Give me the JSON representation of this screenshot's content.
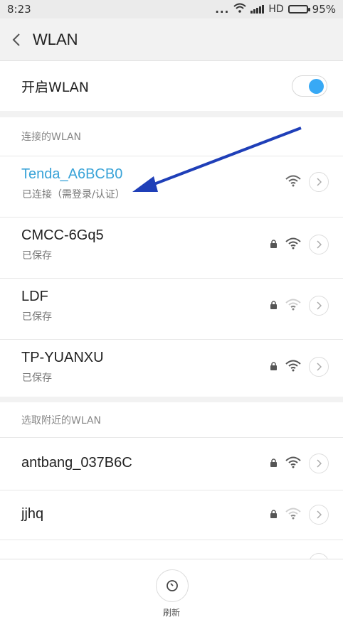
{
  "status_bar": {
    "time": "8:23",
    "dots": "...",
    "network": "HD",
    "battery_percent": "95%",
    "battery_level": 0.95
  },
  "header": {
    "title": "WLAN"
  },
  "wlan_toggle": {
    "label": "开启WLAN",
    "enabled": true
  },
  "connected_section": {
    "heading": "连接的WLAN",
    "networks": [
      {
        "name": "Tenda_A6BCB0",
        "status": "已连接（需登录/认证）",
        "secured": false,
        "signal": 3
      },
      {
        "name": "CMCC-6Gq5",
        "status": "已保存",
        "secured": true,
        "signal": 3
      },
      {
        "name": "LDF",
        "status": "已保存",
        "secured": true,
        "signal": 1
      },
      {
        "name": "TP-YUANXU",
        "status": "已保存",
        "secured": true,
        "signal": 3
      }
    ]
  },
  "nearby_section": {
    "heading": "选取附近的WLAN",
    "networks": [
      {
        "name": "antbang_037B6C",
        "secured": true,
        "signal": 3
      },
      {
        "name": "jjhq",
        "secured": true,
        "signal": 1
      }
    ]
  },
  "bottom_bar": {
    "refresh_label": "刷新"
  },
  "colors": {
    "accent": "#38a9f5",
    "connected_text": "#39a3d8",
    "annotation_arrow": "#1f3fb8"
  }
}
